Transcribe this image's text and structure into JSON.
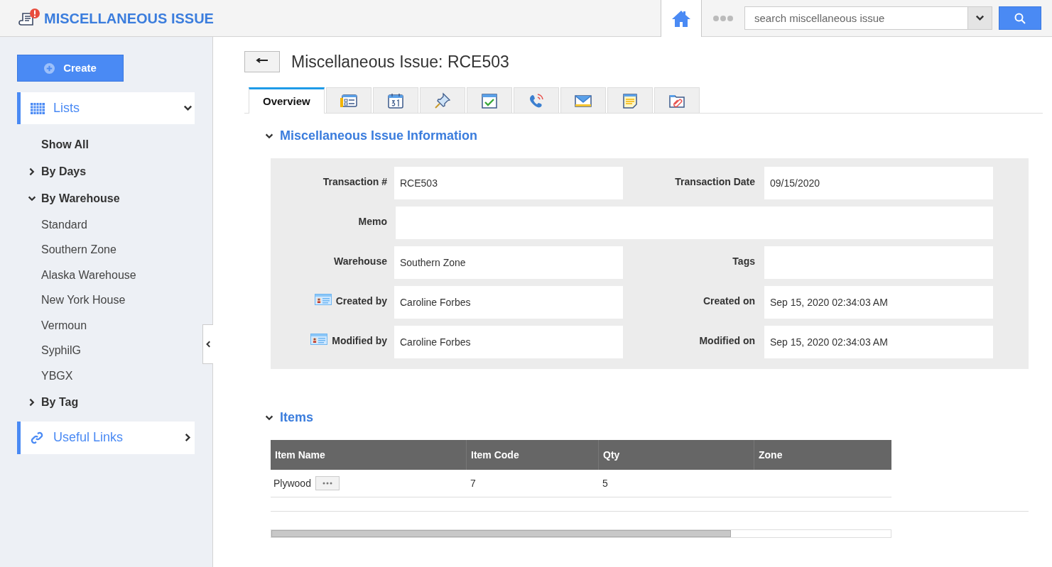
{
  "header": {
    "title": "MISCELLANEOUS ISSUE",
    "search": {
      "placeholder": "search miscellaneous issue"
    }
  },
  "sidebar": {
    "create_button": "Create",
    "lists": {
      "label": "Lists",
      "expanded": true,
      "items": [
        {
          "label": "Show All",
          "kind": "leaf"
        },
        {
          "label": "By Days",
          "kind": "group",
          "expanded": false
        },
        {
          "label": "By Warehouse",
          "kind": "group",
          "expanded": true,
          "children": [
            {
              "label": "Standard"
            },
            {
              "label": "Southern Zone"
            },
            {
              "label": "Alaska Warehouse"
            },
            {
              "label": "New York House"
            },
            {
              "label": "Vermoun"
            },
            {
              "label": "SyphilG"
            },
            {
              "label": "YBGX"
            }
          ]
        },
        {
          "label": "By Tag",
          "kind": "group",
          "expanded": false
        }
      ]
    },
    "useful_links": {
      "label": "Useful Links",
      "expanded": false
    }
  },
  "page": {
    "title": "Miscellaneous Issue: RCE503",
    "tabs": [
      {
        "label": "Overview",
        "selected": true
      },
      {
        "selected": false
      },
      {
        "selected": false
      },
      {
        "selected": false
      },
      {
        "selected": false
      },
      {
        "selected": false
      },
      {
        "selected": false
      },
      {
        "selected": false
      },
      {
        "selected": false
      }
    ],
    "info": {
      "title": "Miscellaneous Issue Information",
      "expanded": true,
      "rows": [
        [
          {
            "label": "Transaction #",
            "value": "RCE503"
          },
          {
            "label": "Transaction Date",
            "value": "09/15/2020"
          }
        ],
        [
          {
            "label": "Memo"
          }
        ],
        [
          {
            "label": "Warehouse",
            "value": "Southern Zone"
          },
          {
            "label": "Tags"
          }
        ],
        [
          {
            "label": "Created by",
            "value": "Caroline Forbes",
            "kind": "user"
          },
          {
            "label": "Created on",
            "value": "Sep 15, 2020 02:34:03 AM"
          }
        ],
        [
          {
            "label": "Modified by",
            "value": "Caroline Forbes",
            "kind": "user"
          },
          {
            "label": "Modified on",
            "value": "Sep 15, 2020 02:34:03 AM"
          }
        ]
      ]
    },
    "items": {
      "title": "Items",
      "expanded": true,
      "columns": [
        "Item Name",
        "Item Code",
        "Qty",
        "Zone"
      ],
      "rows": [
        {
          "cells": [
            "Plywood",
            "7",
            "5",
            ""
          ],
          "has_menu": true
        }
      ]
    }
  }
}
